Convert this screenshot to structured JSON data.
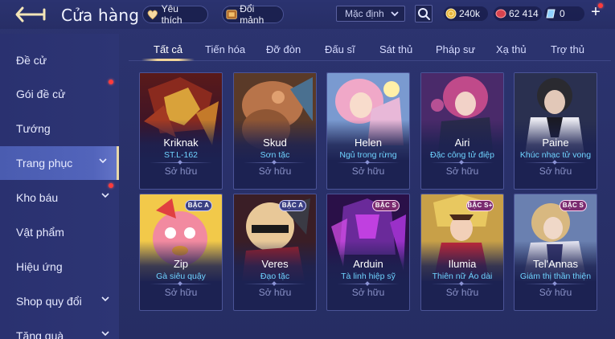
{
  "header": {
    "title": "Cửa hàng",
    "favorites_label": "Yêu thích",
    "fragments_label": "Đổi mảnh",
    "sort_selected": "Mặc định",
    "gold": "240k",
    "coupons": "62 414",
    "vouchers": "0"
  },
  "sidebar": {
    "items": [
      {
        "label": "Đề cử"
      },
      {
        "label": "Gói đề cử"
      },
      {
        "label": "Tướng"
      },
      {
        "label": "Trang phục"
      },
      {
        "label": "Kho báu"
      },
      {
        "label": "Vật phẩm"
      },
      {
        "label": "Hiệu ứng"
      },
      {
        "label": "Shop quy đổi"
      },
      {
        "label": "Tặng quà"
      }
    ]
  },
  "tabs": [
    "Tất cả",
    "Tiến hóa",
    "Đỡ đòn",
    "Đấu sĩ",
    "Sát thủ",
    "Pháp sư",
    "Xạ thủ",
    "Trợ thủ"
  ],
  "cards": [
    {
      "hero": "Kriknak",
      "skin": "ST.L-162",
      "status": "Sở hữu",
      "badge": ""
    },
    {
      "hero": "Skud",
      "skin": "Sơn tặc",
      "status": "Sở hữu",
      "badge": ""
    },
    {
      "hero": "Helen",
      "skin": "Ngủ trong rừng",
      "status": "Sở hữu",
      "badge": ""
    },
    {
      "hero": "Airi",
      "skin": "Đặc công tử điệp",
      "status": "Sở hữu",
      "badge": ""
    },
    {
      "hero": "Paine",
      "skin": "Khúc nhạc tử vong",
      "status": "Sở hữu",
      "badge": ""
    },
    {
      "hero": "Zip",
      "skin": "Gà siêu quậy",
      "status": "Sở hữu",
      "badge": "BẬC A"
    },
    {
      "hero": "Veres",
      "skin": "Đạo tặc",
      "status": "Sở hữu",
      "badge": "BẬC A"
    },
    {
      "hero": "Arduin",
      "skin": "Tà linh hiệp sỹ",
      "status": "Sở hữu",
      "badge": "BẬC S"
    },
    {
      "hero": "Ilumia",
      "skin": "Thiên nữ Áo dài",
      "status": "Sở hữu",
      "badge": "BẬC S+"
    },
    {
      "hero": "Tel'Annas",
      "skin": "Giám thị thần thiện",
      "status": "Sở hữu",
      "badge": "BẬC S"
    }
  ],
  "colors": {
    "accent_gold": "#f3d69a",
    "skin_name": "#6fd3ff",
    "notification": "#ff3b3b"
  }
}
